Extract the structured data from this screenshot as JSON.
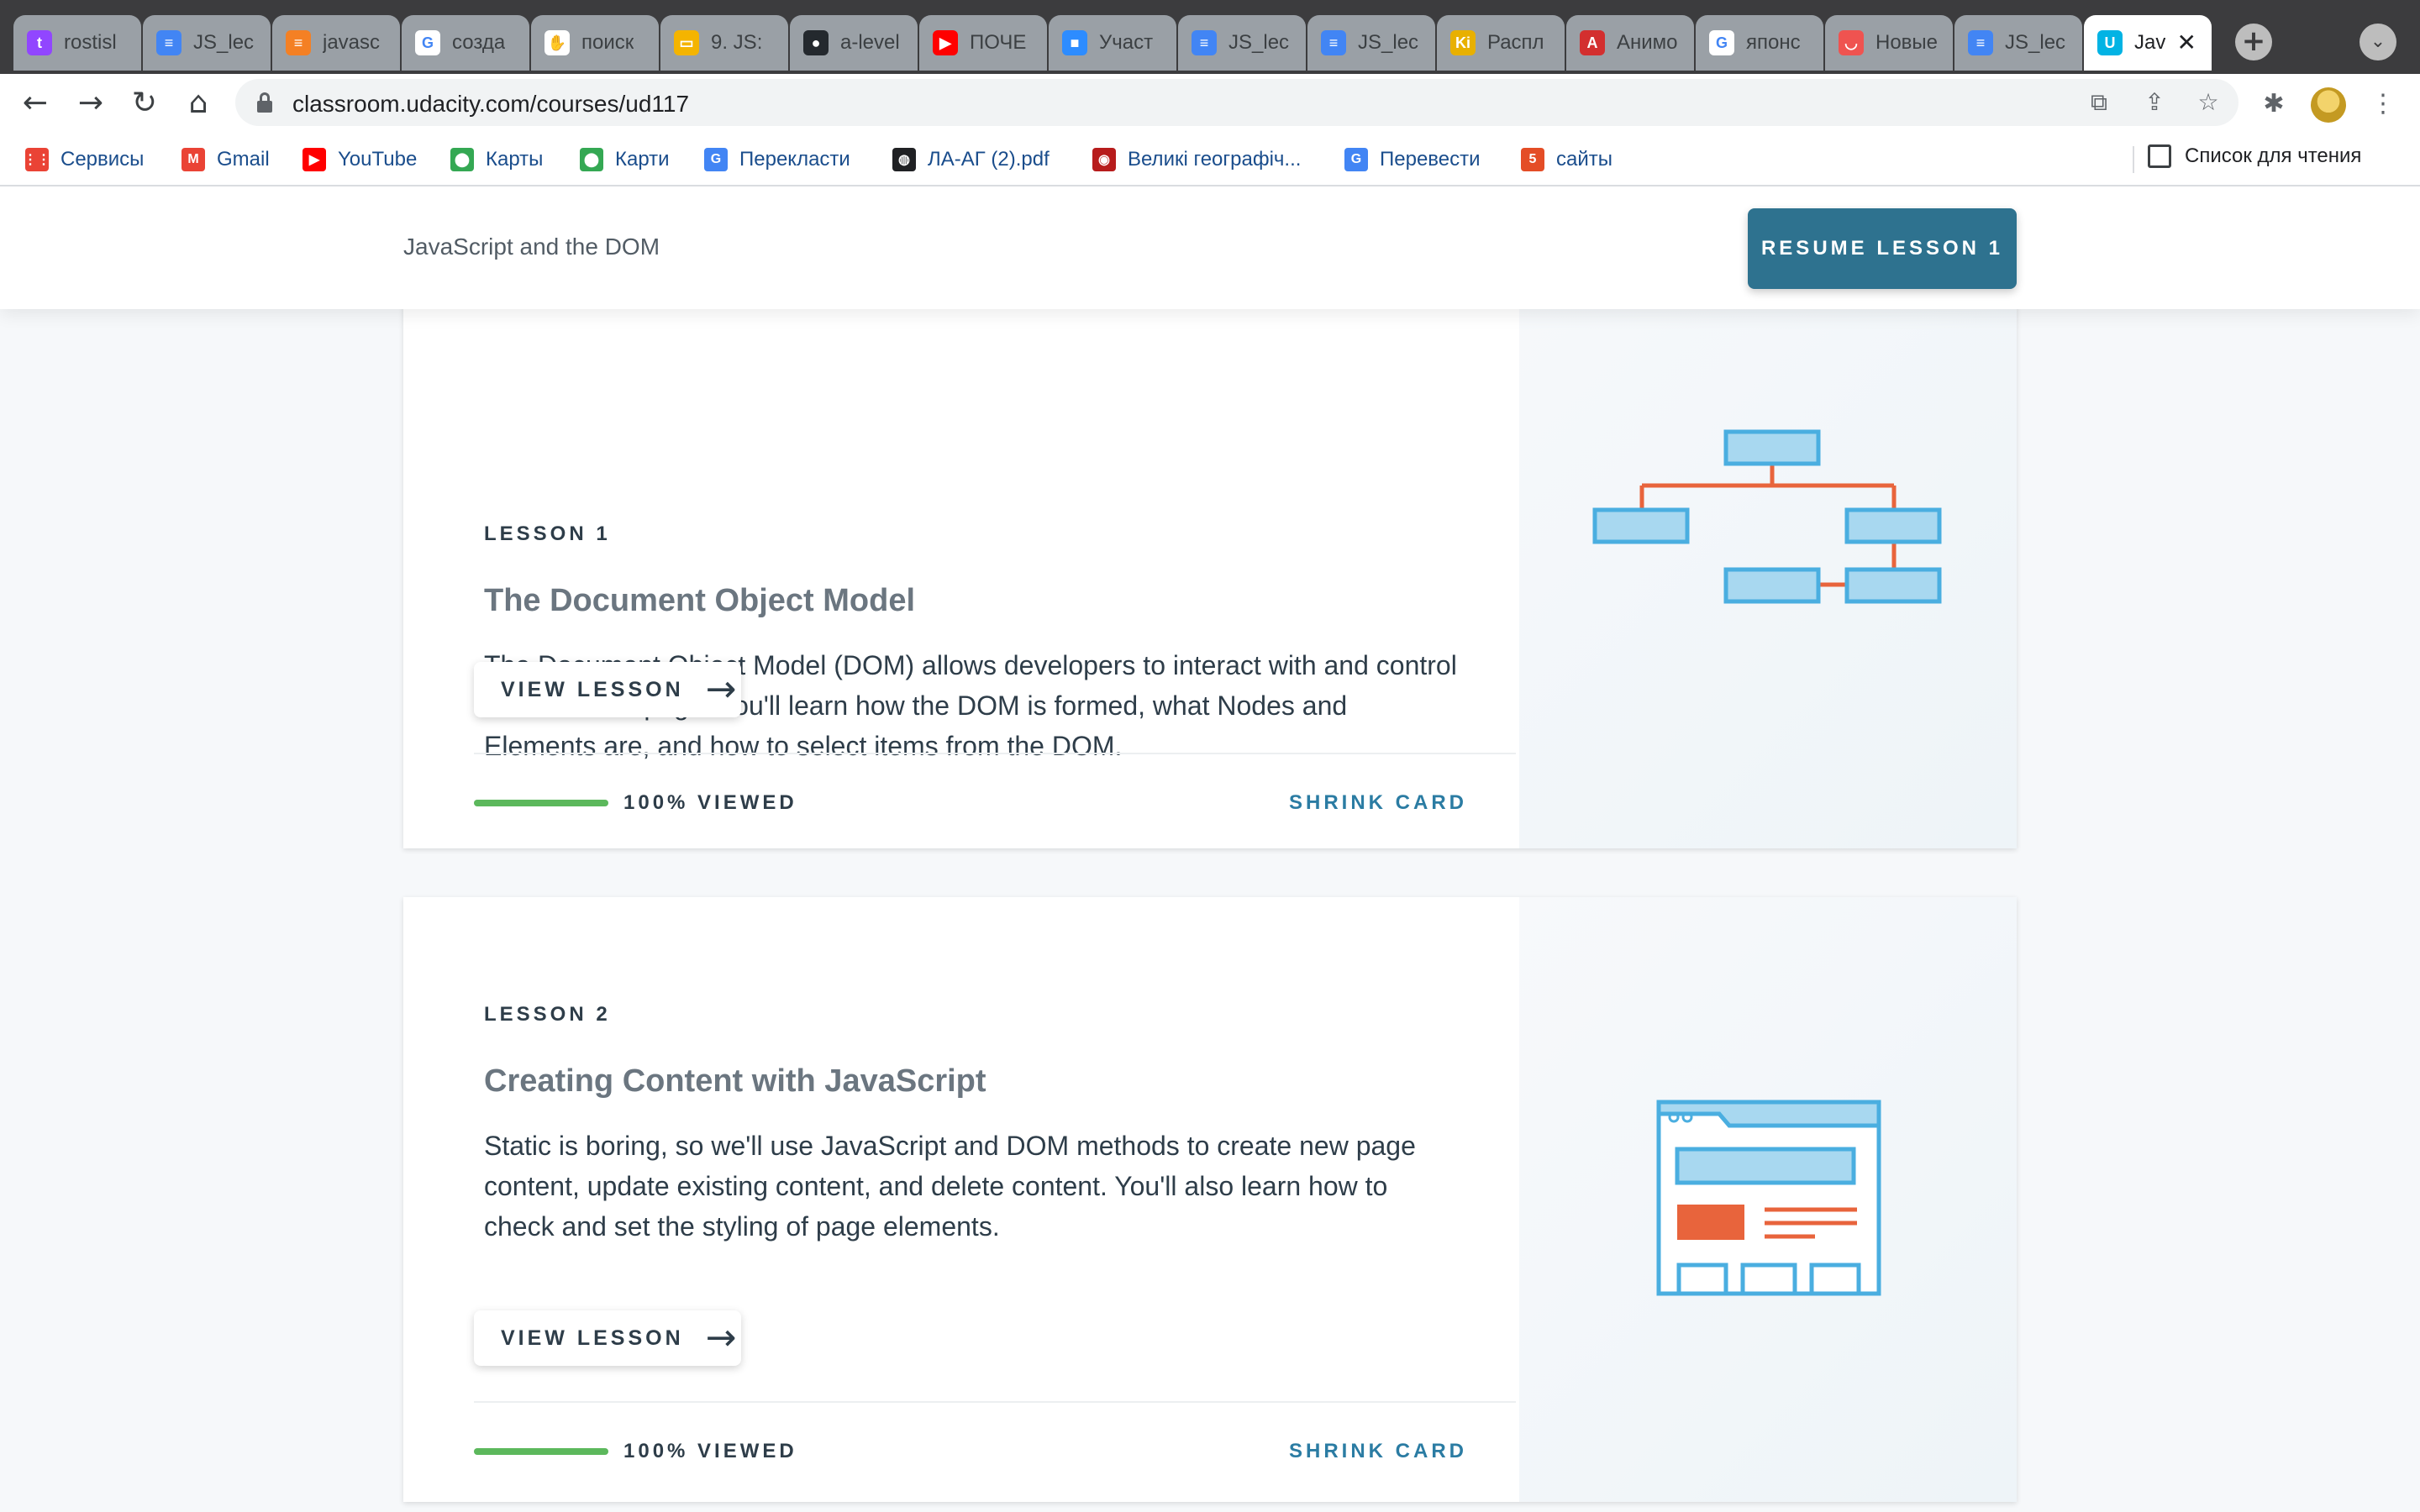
{
  "browser": {
    "tabs": [
      {
        "title": "rostisl",
        "icon": "twitch-icon",
        "color": "#9146ff",
        "glyph": "t"
      },
      {
        "title": "JS_lec",
        "icon": "docs-icon",
        "color": "#4285f4",
        "glyph": "≡"
      },
      {
        "title": "javasc",
        "icon": "stackoverflow-icon",
        "color": "#f48024",
        "glyph": "≡"
      },
      {
        "title": "созда",
        "icon": "google-icon",
        "color": "#ffffff",
        "glyph": "G"
      },
      {
        "title": "поиск",
        "icon": "hand-icon",
        "color": "#ffffff",
        "glyph": "✋"
      },
      {
        "title": "9. JS:",
        "icon": "slides-icon",
        "color": "#f4b400",
        "glyph": "▭"
      },
      {
        "title": "a-level",
        "icon": "github-icon",
        "color": "#24292e",
        "glyph": "●"
      },
      {
        "title": "ПОЧЕ",
        "icon": "youtube-icon",
        "color": "#ff0000",
        "glyph": "▶"
      },
      {
        "title": "Участ",
        "icon": "zoom-icon",
        "color": "#2d8cff",
        "glyph": "■"
      },
      {
        "title": "JS_lec",
        "icon": "docs-icon",
        "color": "#4285f4",
        "glyph": "≡"
      },
      {
        "title": "JS_lec",
        "icon": "docs-icon",
        "color": "#4285f4",
        "glyph": "≡"
      },
      {
        "title": "Распл",
        "icon": "ki-icon",
        "color": "#e8b000",
        "glyph": "Ki"
      },
      {
        "title": "Анимо",
        "icon": "anime-icon",
        "color": "#d32f2f",
        "glyph": "A"
      },
      {
        "title": "японс",
        "icon": "google-icon",
        "color": "#ffffff",
        "glyph": "G"
      },
      {
        "title": "Новые",
        "icon": "shop-icon",
        "color": "#ef5350",
        "glyph": "◡"
      },
      {
        "title": "JS_lec",
        "icon": "docs-icon",
        "color": "#4285f4",
        "glyph": "≡"
      },
      {
        "title": "Jav",
        "icon": "udacity-icon",
        "color": "#02b3e4",
        "glyph": "U",
        "active": true
      }
    ],
    "url": "classroom.udacity.com/courses/ud117",
    "bookmarks": [
      {
        "label": "Сервисы",
        "icon": "apps-grid-icon",
        "color": "#ea4335",
        "glyph": "⋮⋮"
      },
      {
        "label": "Gmail",
        "icon": "gmail-icon",
        "color": "#ea4335",
        "glyph": "M"
      },
      {
        "label": "YouTube",
        "icon": "youtube-icon",
        "color": "#ff0000",
        "glyph": "▶"
      },
      {
        "label": "Карты",
        "icon": "maps-pin-icon",
        "color": "#34a853",
        "glyph": "⬤"
      },
      {
        "label": "Карти",
        "icon": "maps-pin-icon",
        "color": "#34a853",
        "glyph": "⬤"
      },
      {
        "label": "Перекласти",
        "icon": "translate-icon",
        "color": "#4285f4",
        "glyph": "G"
      },
      {
        "label": "ЛА-АГ (2).pdf",
        "icon": "globe-icon",
        "color": "#202124",
        "glyph": "◍"
      },
      {
        "label": "Великі географіч...",
        "icon": "site-icon",
        "color": "#b71c1c",
        "glyph": "◉"
      },
      {
        "label": "Перевести",
        "icon": "translate-icon",
        "color": "#4285f4",
        "glyph": "G"
      },
      {
        "label": "сайты",
        "icon": "html5-icon",
        "color": "#e44d26",
        "glyph": "5"
      }
    ],
    "reading_list": "Список для чтения"
  },
  "header": {
    "course_title": "JavaScript and the DOM",
    "resume_label": "RESUME LESSON 1"
  },
  "lessons": [
    {
      "number": "LESSON 1",
      "title": "The Document Object Model",
      "description": "The Document Object Model (DOM) allows developers to interact with and control the rendered page. You'll learn how the DOM is formed, what Nodes and Elements are, and how to select items from the DOM.",
      "view_label": "VIEW LESSON",
      "progress": 1.0,
      "progress_label": "100% VIEWED",
      "shrink_label": "SHRINK CARD",
      "illustration": "dom-tree-icon"
    },
    {
      "number": "LESSON 2",
      "title": "Creating Content with JavaScript",
      "description": "Static is boring, so we'll use JavaScript and DOM methods to create new page content, update existing content, and delete content. You'll also learn how to check and set the styling of page elements.",
      "view_label": "VIEW LESSON",
      "progress": 1.0,
      "progress_label": "100% VIEWED",
      "shrink_label": "SHRINK CARD",
      "illustration": "webpage-layout-icon"
    }
  ],
  "colors": {
    "accent": "#2e728f",
    "progress": "#5cb85c",
    "illustration_blue": "#4aaee0",
    "illustration_fill": "#a8d8f0",
    "illustration_orange": "#e8643c"
  }
}
